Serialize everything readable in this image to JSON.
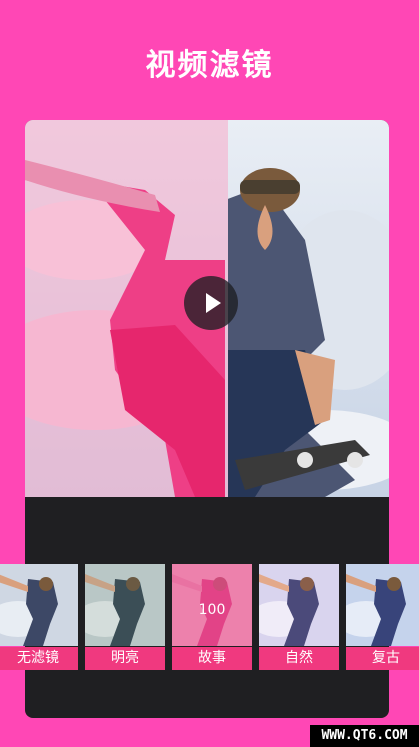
{
  "header": {
    "title": "视频滤镜"
  },
  "preview": {
    "play_icon": "play-icon"
  },
  "filters": [
    {
      "label": "无滤镜",
      "style": "original"
    },
    {
      "label": "明亮",
      "style": "bright"
    },
    {
      "label": "故事",
      "style": "story",
      "intensity": "100",
      "selected": true
    },
    {
      "label": "自然",
      "style": "natural"
    },
    {
      "label": "复古",
      "style": "retro"
    }
  ],
  "colors": {
    "background": "#ff47b5",
    "accent": "#f0397f",
    "panel": "#1f1f22"
  },
  "watermark": "WWW.QT6.COM"
}
